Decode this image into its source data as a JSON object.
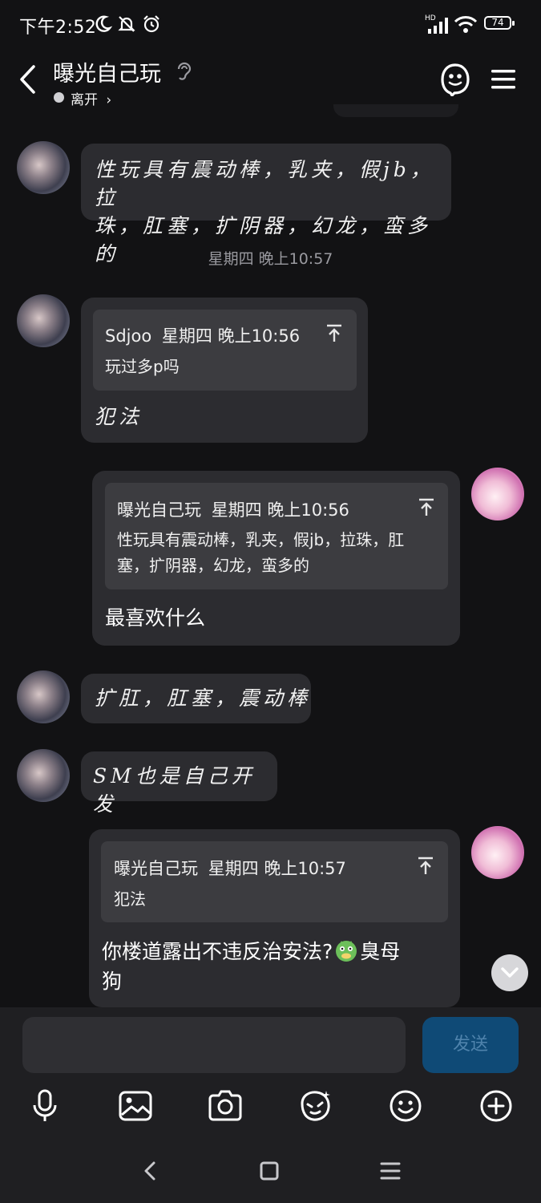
{
  "status_bar": {
    "time": "下午2:52",
    "battery": "74",
    "network": "HD"
  },
  "header": {
    "title": "曝光自己玩",
    "presence": "离开",
    "presence_chevron": "›"
  },
  "messages": [
    {
      "from": "them",
      "text_lines": [
        "性玩具有震动棒，乳夹，假jb，拉",
        "珠，肛塞，扩阴器，幻龙，蛮多的"
      ]
    },
    {
      "type": "timestamp",
      "text": "星期四 晚上10:57"
    },
    {
      "from": "them",
      "quote": {
        "author": "Sdjoo",
        "time": "星期四 晚上10:56",
        "text": "玩过多p吗"
      },
      "text": "犯法"
    },
    {
      "from": "me",
      "quote": {
        "author": "曝光自己玩",
        "time": "星期四 晚上10:56",
        "text_lines": [
          "性玩具有震动棒，乳夹，假jb，拉珠，肛",
          "塞，扩阴器，幻龙，蛮多的"
        ]
      },
      "text": "最喜欢什么"
    },
    {
      "from": "them",
      "text": "扩肛，肛塞，震动棒"
    },
    {
      "from": "them",
      "text": "SM也是自己开发"
    },
    {
      "from": "me",
      "quote": {
        "author": "曝光自己玩",
        "time": "星期四 晚上10:57",
        "text": "犯法"
      },
      "text_line1": "你楼道露出不违反治安法?",
      "emoji": "bird-emoji",
      "text_line1_end": "臭母",
      "text_line2": "狗"
    }
  ],
  "input": {
    "value": "",
    "placeholder": "",
    "send_label": "发送"
  },
  "toolbar": [
    "microphone-icon",
    "image-icon",
    "camera-icon",
    "sticker-icon",
    "emoji-icon",
    "plus-icon"
  ],
  "colors": {
    "background": "#121214",
    "bubble": "#2c2c30",
    "quote": "#3c3c40",
    "send_button": "#0f4a76"
  }
}
